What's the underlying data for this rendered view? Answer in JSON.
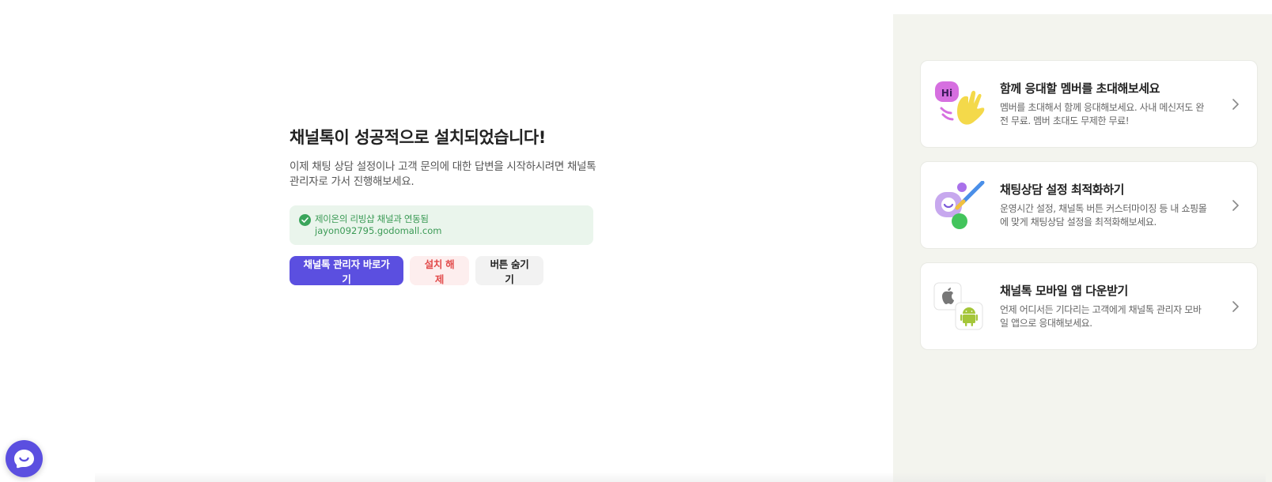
{
  "main": {
    "title": "채널톡이 성공적으로 설치되었습니다!",
    "description": "이제 채팅 상담 설정이나 고객 문의에 대한 답변을 시작하시려면 채널톡 관리자로 가서 진행해보세요.",
    "linked": {
      "label": "제이온의 리빙샵 채널과 연동됨",
      "domain": "jayon092795.godomall.com"
    },
    "buttons": {
      "admin": "채널톡 관리자 바로가기",
      "uninstall": "설치 해제",
      "hide": "버튼 숨기기"
    }
  },
  "side": {
    "cards": [
      {
        "title": "함께 응대할 멤버를 초대해보세요",
        "description": "멤버를 초대해서 함께 응대해보세요. 사내 메신저도 완전 무료. 멤버 초대도 무제한 무료!",
        "art_text": "Hi"
      },
      {
        "title": "채팅상담 설정 최적화하기",
        "description": "운영시간 설정, 채널톡 버튼 커스터마이징 등 내 쇼핑몰에 맞게 채팅상담 설정을 최적화해보세요."
      },
      {
        "title": "채널톡 모바일 앱 다운받기",
        "description": "언제 어디서든 기다리는 고객에게 채널톡 관리자 모바일 앱으로 응대해보세요."
      }
    ]
  },
  "colors": {
    "primary": "#5b4fe0",
    "danger": "#e24b4b",
    "success": "#3aa55b",
    "panel_bg": "#f3f4ee"
  }
}
